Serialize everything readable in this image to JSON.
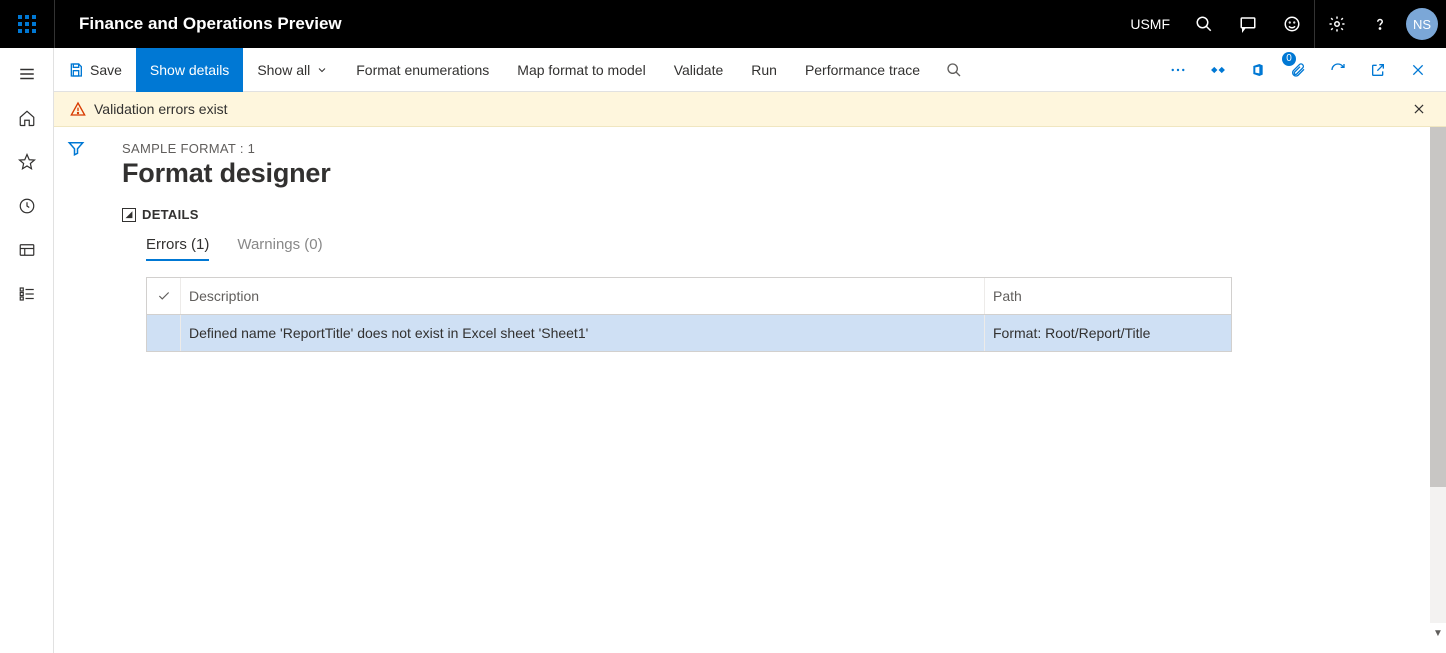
{
  "header": {
    "app_title": "Finance and Operations Preview",
    "entity": "USMF",
    "avatar_initials": "NS"
  },
  "commands": {
    "save": "Save",
    "show_details": "Show details",
    "show_all": "Show all",
    "format_enumerations": "Format enumerations",
    "map_format": "Map format to model",
    "validate": "Validate",
    "run": "Run",
    "performance_trace": "Performance trace",
    "attachments_badge": "0"
  },
  "banner": {
    "message": "Validation errors exist"
  },
  "page": {
    "breadcrumb": "SAMPLE FORMAT : 1",
    "title": "Format designer",
    "details_label": "DETAILS"
  },
  "tabs": {
    "errors": "Errors (1)",
    "warnings": "Warnings (0)"
  },
  "grid": {
    "columns": {
      "description": "Description",
      "path": "Path"
    },
    "rows": [
      {
        "description": "Defined name 'ReportTitle' does not exist in Excel sheet 'Sheet1'",
        "path": "Format: Root/Report/Title"
      }
    ]
  }
}
